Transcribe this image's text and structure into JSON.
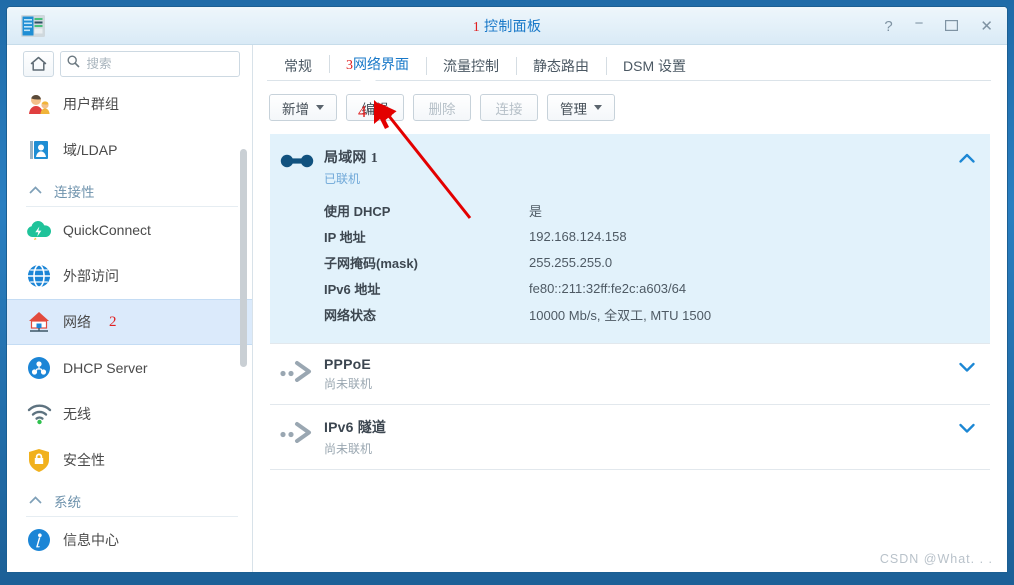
{
  "window": {
    "title": "控制面板",
    "title_marker": "1",
    "controls": {
      "help": "?",
      "minimize": "−",
      "maximize": "❐",
      "close": "✕"
    }
  },
  "sidebar": {
    "home_button_label": "⌂",
    "search": {
      "placeholder": "搜索",
      "value": ""
    },
    "items": [
      {
        "label": "用户群组",
        "icon": "users-icon",
        "type": "item",
        "selected": false
      },
      {
        "label": "域/LDAP",
        "icon": "domain-ldap-icon",
        "type": "item",
        "selected": false
      },
      {
        "label": "连接性",
        "icon": "chevron-up-icon",
        "type": "group"
      },
      {
        "label": "QuickConnect",
        "icon": "quickconnect-icon",
        "type": "item",
        "selected": false
      },
      {
        "label": "外部访问",
        "icon": "globe-icon",
        "type": "item",
        "selected": false
      },
      {
        "label": "网络",
        "marker": "2",
        "icon": "network-home-icon",
        "type": "item",
        "selected": true
      },
      {
        "label": "DHCP Server",
        "icon": "dhcp-server-icon",
        "type": "item",
        "selected": false
      },
      {
        "label": "无线",
        "icon": "wifi-icon",
        "type": "item",
        "selected": false
      },
      {
        "label": "安全性",
        "icon": "shield-icon",
        "type": "item",
        "selected": false
      },
      {
        "label": "系统",
        "icon": "chevron-up-icon",
        "type": "group"
      },
      {
        "label": "信息中心",
        "icon": "info-icon",
        "type": "item",
        "selected": false
      }
    ]
  },
  "main": {
    "tabs": [
      {
        "label": "常规",
        "active": false
      },
      {
        "label": "网络界面",
        "marker": "3",
        "active": true
      },
      {
        "label": "流量控制",
        "active": false
      },
      {
        "label": "静态路由",
        "active": false
      },
      {
        "label": "DSM 设置",
        "active": false
      }
    ],
    "toolbar": [
      {
        "label": "新增",
        "caret": true,
        "disabled": false
      },
      {
        "label": "编辑",
        "caret": false,
        "disabled": false,
        "marker": "4"
      },
      {
        "label": "删除",
        "caret": false,
        "disabled": true
      },
      {
        "label": "连接",
        "caret": false,
        "disabled": true
      },
      {
        "label": "管理",
        "caret": true,
        "disabled": false
      }
    ],
    "interfaces": [
      {
        "name": "局域网",
        "name_num": "1",
        "status": "已联机",
        "connected": true,
        "expanded": true,
        "icon": "lan-link-icon",
        "chevron": "chevron-up-icon",
        "details": [
          {
            "key": "使用 DHCP",
            "value": "是"
          },
          {
            "key": "IP 地址",
            "value": "192.168.124.158"
          },
          {
            "key": "子网掩码(mask)",
            "value": "255.255.255.0"
          },
          {
            "key": "IPv6 地址",
            "value": "fe80::211:32ff:fe2c:a603/64"
          },
          {
            "key": "网络状态",
            "value": "10000 Mb/s, 全双工, MTU 1500"
          }
        ]
      },
      {
        "name": "PPPoE",
        "name_num": "",
        "status": "尚未联机",
        "connected": false,
        "expanded": false,
        "icon": "pppoe-arrow-icon",
        "chevron": "chevron-down-icon",
        "details": []
      },
      {
        "name": "IPv6 隧道",
        "name_num": "",
        "status": "尚未联机",
        "connected": false,
        "expanded": false,
        "icon": "pppoe-arrow-icon",
        "chevron": "chevron-down-icon",
        "details": []
      }
    ]
  },
  "annotations": {
    "arrow_color": "#e30000",
    "edit_marker": "4"
  },
  "watermark": "CSDN @What. . .",
  "colors": {
    "accent": "#1878c8",
    "marker_red": "#e02020",
    "selected_row": "#dbeafb",
    "card_expanded": "#e2f2fb",
    "desktop": "#2a7fc1"
  }
}
